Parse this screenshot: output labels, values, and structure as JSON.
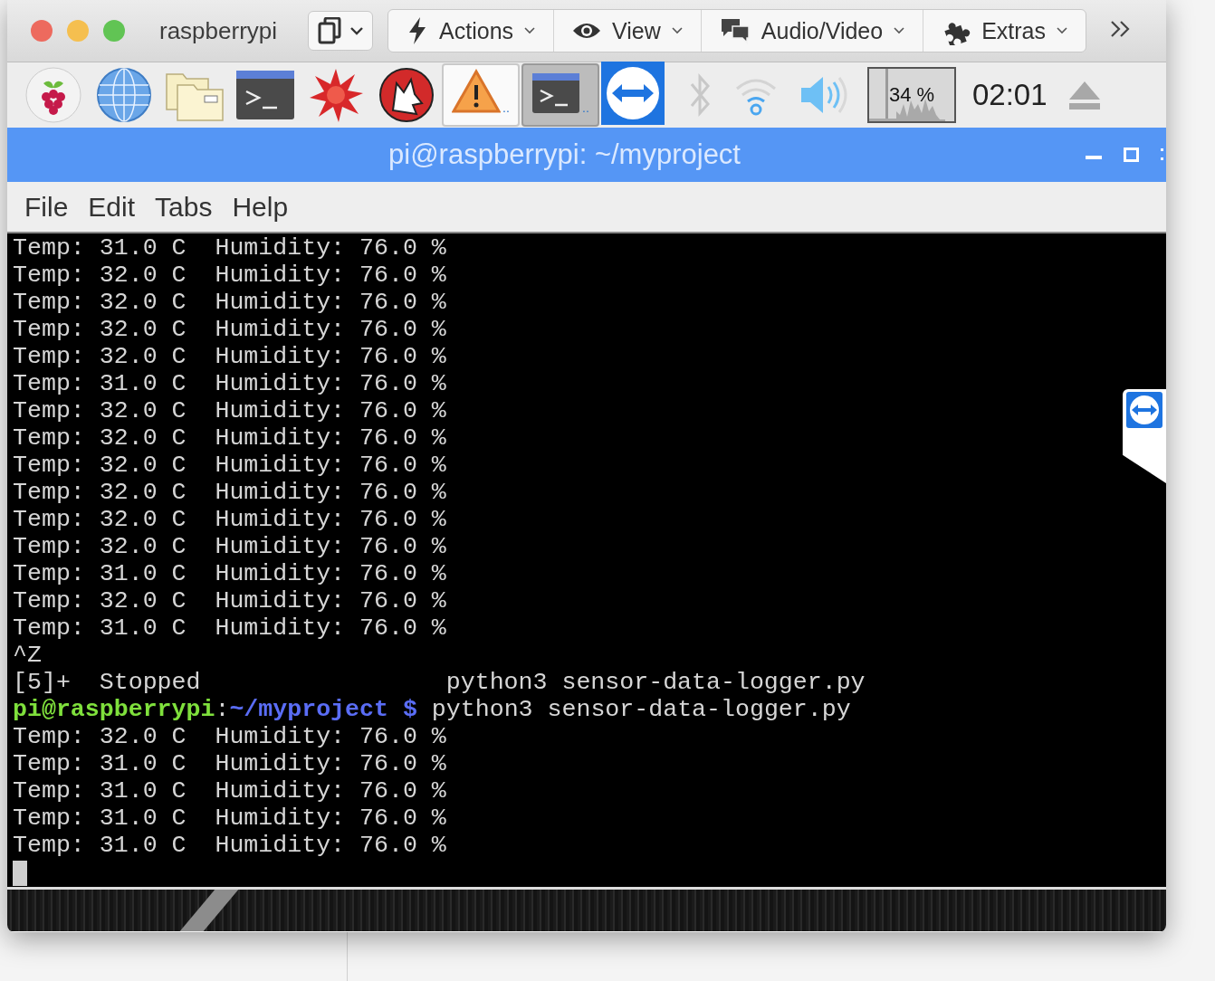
{
  "window": {
    "title": "raspberrypi"
  },
  "toolbar": {
    "buttons": [
      {
        "label": "Actions"
      },
      {
        "label": "View"
      },
      {
        "label": "Audio/Video"
      },
      {
        "label": "Extras"
      }
    ]
  },
  "panel": {
    "taskbar": [
      {
        "label": "..",
        "selected": false
      },
      {
        "label": "..",
        "selected": true
      }
    ],
    "cpu_reading": "34 %",
    "clock": "02:01"
  },
  "terminal": {
    "title": "pi@raspberrypi: ~/myproject",
    "menu": [
      "File",
      "Edit",
      "Tabs",
      "Help"
    ],
    "lines": [
      {
        "kind": "output",
        "text": "Temp: 31.0 C  Humidity: 76.0 %"
      },
      {
        "kind": "output",
        "text": "Temp: 32.0 C  Humidity: 76.0 %"
      },
      {
        "kind": "output",
        "text": "Temp: 32.0 C  Humidity: 76.0 %"
      },
      {
        "kind": "output",
        "text": "Temp: 32.0 C  Humidity: 76.0 %"
      },
      {
        "kind": "output",
        "text": "Temp: 32.0 C  Humidity: 76.0 %"
      },
      {
        "kind": "output",
        "text": "Temp: 31.0 C  Humidity: 76.0 %"
      },
      {
        "kind": "output",
        "text": "Temp: 32.0 C  Humidity: 76.0 %"
      },
      {
        "kind": "output",
        "text": "Temp: 32.0 C  Humidity: 76.0 %"
      },
      {
        "kind": "output",
        "text": "Temp: 32.0 C  Humidity: 76.0 %"
      },
      {
        "kind": "output",
        "text": "Temp: 32.0 C  Humidity: 76.0 %"
      },
      {
        "kind": "output",
        "text": "Temp: 32.0 C  Humidity: 76.0 %"
      },
      {
        "kind": "output",
        "text": "Temp: 32.0 C  Humidity: 76.0 %"
      },
      {
        "kind": "output",
        "text": "Temp: 31.0 C  Humidity: 76.0 %"
      },
      {
        "kind": "output",
        "text": "Temp: 32.0 C  Humidity: 76.0 %"
      },
      {
        "kind": "output",
        "text": "Temp: 31.0 C  Humidity: 76.0 %"
      },
      {
        "kind": "output",
        "text": "^Z"
      },
      {
        "kind": "output",
        "text": "[5]+  Stopped                 python3 sensor-data-logger.py"
      },
      {
        "kind": "prompt",
        "user": "pi@raspberrypi",
        "separator": ":",
        "path": "~/myproject $",
        "command": "python3 sensor-data-logger.py"
      },
      {
        "kind": "output",
        "text": "Temp: 32.0 C  Humidity: 76.0 %"
      },
      {
        "kind": "output",
        "text": "Temp: 31.0 C  Humidity: 76.0 %"
      },
      {
        "kind": "output",
        "text": "Temp: 31.0 C  Humidity: 76.0 %"
      },
      {
        "kind": "output",
        "text": "Temp: 31.0 C  Humidity: 76.0 %"
      },
      {
        "kind": "output",
        "text": "Temp: 31.0 C  Humidity: 76.0 %"
      },
      {
        "kind": "cursor"
      }
    ]
  }
}
